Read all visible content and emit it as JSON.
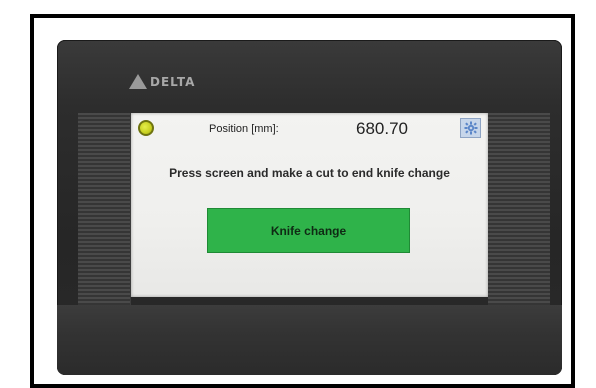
{
  "device": {
    "brand": "DELTA"
  },
  "screen": {
    "status_led_color": "#d4dc2a",
    "position_label": "Position  [mm]:",
    "position_value": "680.70",
    "settings_icon": "gear-icon",
    "instruction": "Press screen and make a cut to end knife change",
    "knife_change_label": "Knife change",
    "knife_change_color": "#2fb34a"
  }
}
